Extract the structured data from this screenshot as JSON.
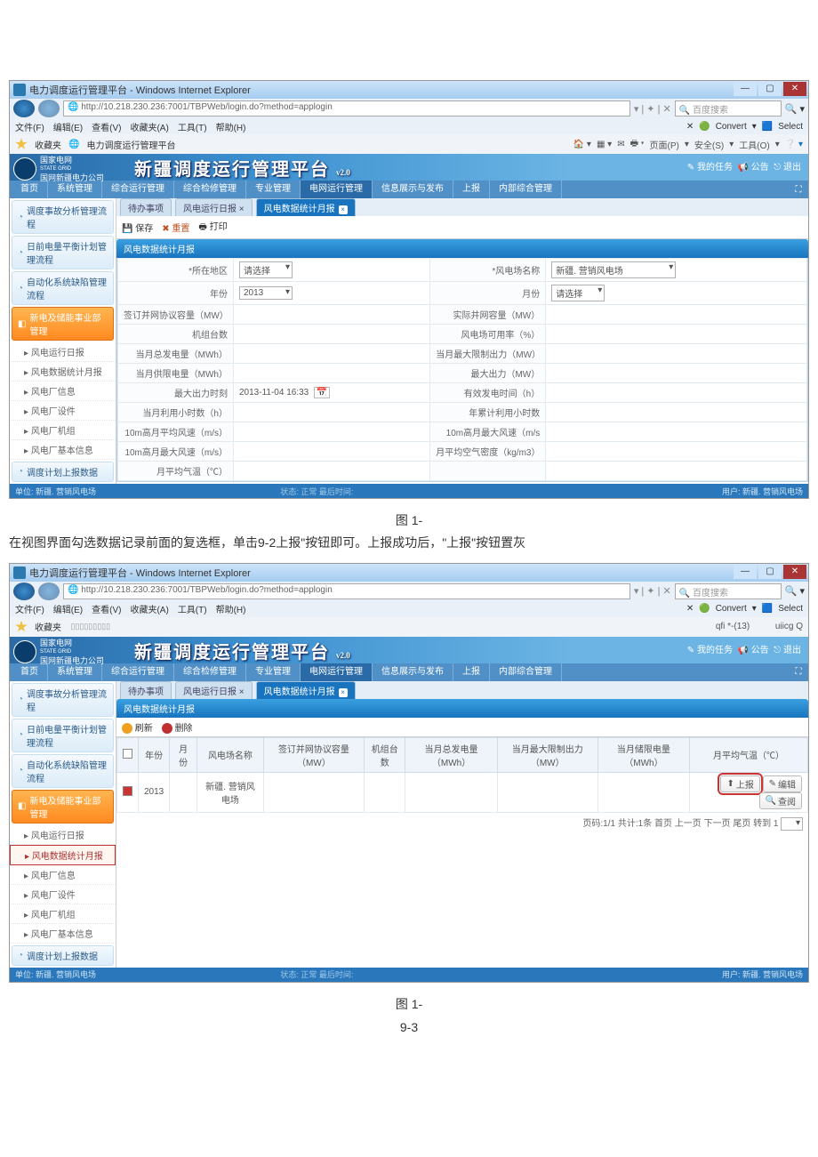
{
  "browser": {
    "window_title": "电力调度运行管理平台 - Windows Internet Explorer",
    "url": "http://10.218.230.236:7001/TBPWeb/login.do?method=applogin",
    "search_placeholder": "百度搜索",
    "search_icon_hint": "🔍",
    "menus": [
      "文件(F)",
      "编辑(E)",
      "查看(V)",
      "收藏夹(A)",
      "工具(T)",
      "帮助(H)"
    ],
    "convert_btn": "Convert",
    "select_btn": "Select",
    "fav_label": "收藏夹",
    "fav_item": "电力调度运行管理平台",
    "ie_tools": [
      "页面(P)",
      "安全(S)",
      "工具(O)"
    ]
  },
  "app": {
    "logo_line1": "国家电网",
    "logo_line2": "STATE GRID",
    "logo_line3": "国网新疆电力公司",
    "title": "新疆调度运行管理平台",
    "version": "v2.0",
    "header_right1": "我的任务",
    "header_right2": "公告",
    "header_right_extra": "退出",
    "main_nav": [
      "首页",
      "系统管理",
      "综合运行管理",
      "综合检修管理",
      "专业管理",
      "电网运行管理",
      "信息展示与发布",
      "上报",
      "内部综合管理"
    ],
    "main_nav_active_index": 5,
    "statusbar_left": "单位: 新疆. 营销风电场",
    "statusbar_mid": "状态: 正常  最后时间:",
    "statusbar_right": "用户: 新疆. 营销风电场"
  },
  "sidebar": {
    "groups": [
      {
        "label": "调度事故分析管理流程",
        "type": "group"
      },
      {
        "label": "日前电量平衡计划管理流程",
        "type": "group"
      },
      {
        "label": "自动化系统缺陷管理流程",
        "type": "group"
      },
      {
        "label": "新电及储能事业部管理",
        "type": "orange"
      }
    ],
    "items": [
      "风电运行日报",
      "风电数据统计月报",
      "风电厂信息",
      "风电厂设件",
      "风电厂机组",
      "风电厂基本信息"
    ],
    "last_group": "调度计划上报数据"
  },
  "screenshot1": {
    "tabs": [
      "待办事项",
      "风电运行日报 ×",
      "风电数据统计月报"
    ],
    "active_tab_index": 2,
    "toolbar": {
      "save": "保存",
      "reset": "重置",
      "print": "打印"
    },
    "section": "风电数据统计月报",
    "fields": {
      "row1": {
        "l1": "*所在地区",
        "v1": "请选择",
        "l2": "*风电场名称",
        "v2": "新疆. 营销风电场"
      },
      "row2": {
        "l1": "年份",
        "v1": "2013",
        "l2": "月份",
        "v2": "请选择"
      },
      "row3": {
        "l1": "签订并网协议容量（MW）",
        "l2": "实际并网容量（MW）"
      },
      "row4": {
        "l1": "机组台数",
        "l2": "风电场可用率（%）"
      },
      "row5": {
        "l1": "当月总发电量（MWh）",
        "l2": "当月最大限制出力（MW）"
      },
      "row6": {
        "l1": "当月供限电量（MWh）",
        "l2": "最大出力（MW）"
      },
      "row7": {
        "l1": "最大出力时刻",
        "v1": "2013-11-04 16:33",
        "l2": "有效发电时间（h）"
      },
      "row8": {
        "l1": "当月利用小时数（h）",
        "l2": "年累计利用小时数"
      },
      "row9": {
        "l1": "10m高月平均风速（m/s）",
        "l2": "10m高月最大风速（m/s"
      },
      "row10": {
        "l1": "10m高月最大风速（m/s）",
        "l2": "月平均空气密度（kg/m3）"
      },
      "row11": {
        "l1": "月平均气温（℃）"
      }
    }
  },
  "screenshot2": {
    "fav_extra_left": "",
    "fav_extra_right1": "qfi *-(13)",
    "fav_extra_right2": "uiicg Q",
    "tabs": [
      "待办事项",
      "风电运行日报 ×",
      "风电数据统计月报"
    ],
    "active_tab_index": 2,
    "section": "风电数据统计月报",
    "toolbar": {
      "refresh": "刷新",
      "delete": "删除"
    },
    "grid": {
      "headers": [
        "",
        "年份",
        "月份",
        "风电场名称",
        "签订并网协议容量（MW）",
        "机组台数",
        "当月总发电量（MWh）",
        "当月最大限制出力（MW）",
        "当月储限电量（MWh）",
        "月平均气温（℃）"
      ],
      "row": {
        "year": "2013",
        "month": "",
        "plant": "新疆. 营销风电场"
      },
      "actions": {
        "upload": "上报",
        "edit": "编辑",
        "view": "查阅"
      },
      "pager": "页码:1/1  共计:1条  首页  上一页  下一页  尾页  转到 1"
    },
    "sidebar_boxed_index": 1
  },
  "doc": {
    "caption1": "图 1-",
    "body": "在视图界面勾选数据记录前面的复选框，单击9-2上报\"按钮即可。上报成功后，\"上报\"按钮置灰",
    "caption2a": "图 1-",
    "caption2b": "9-3"
  }
}
